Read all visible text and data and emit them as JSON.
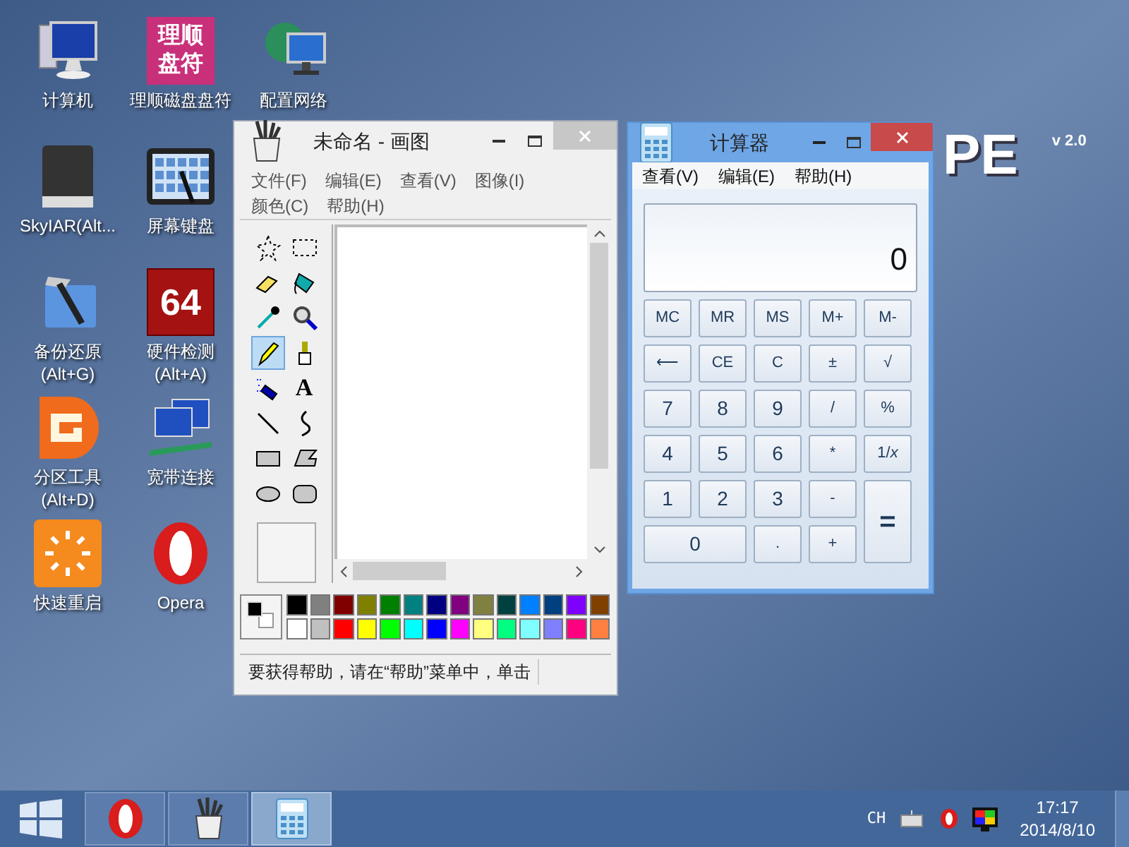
{
  "desktop_icons": [
    {
      "kind": "computer",
      "label": "计算机"
    },
    {
      "kind": "drive",
      "label": "SkyIAR(Alt..."
    },
    {
      "kind": "hammer",
      "label": "备份还原",
      "shortcut": "(Alt+G)"
    },
    {
      "kind": "partition",
      "label": "分区工具",
      "shortcut": "(Alt+D)"
    },
    {
      "kind": "restart",
      "label": "快速重启"
    },
    {
      "kind": "text_tile",
      "tile_text": "理顺盘符",
      "label": "理顺磁盘盘符"
    },
    {
      "kind": "keyboard",
      "label": "屏幕键盘"
    },
    {
      "kind": "number_tile",
      "tile_text": "64",
      "label": "硬件检测",
      "shortcut": "(Alt+A)"
    },
    {
      "kind": "network",
      "label": "宽带连接"
    },
    {
      "kind": "opera",
      "label": "Opera"
    },
    {
      "kind": "globe",
      "label": "配置网络"
    }
  ],
  "wallpaper_logo": {
    "title": "PE",
    "version": "v 2.0"
  },
  "paint_window": {
    "title": "未命名 - 画图",
    "menus": [
      "文件(F)",
      "编辑(E)",
      "查看(V)",
      "图像(I)",
      "颜色(C)",
      "帮助(H)"
    ],
    "tools": [
      {
        "kind": "free_select",
        "selected": false
      },
      {
        "kind": "rect_select",
        "selected": false
      },
      {
        "kind": "eraser",
        "selected": false
      },
      {
        "kind": "fill",
        "selected": false
      },
      {
        "kind": "picker",
        "selected": false
      },
      {
        "kind": "magnifier",
        "selected": false
      },
      {
        "kind": "pencil",
        "selected": true
      },
      {
        "kind": "brush",
        "selected": false
      },
      {
        "kind": "airbrush",
        "selected": false
      },
      {
        "kind": "text",
        "selected": false
      },
      {
        "kind": "line",
        "selected": false
      },
      {
        "kind": "curve",
        "selected": false
      },
      {
        "kind": "rectangle",
        "selected": false
      },
      {
        "kind": "polygon",
        "selected": false
      },
      {
        "kind": "ellipse",
        "selected": false
      },
      {
        "kind": "rounded_rect",
        "selected": false
      }
    ],
    "text_tool_letter": "A",
    "current_colors": [
      {
        "kind": "primary",
        "color": "#000000"
      },
      {
        "kind": "secondary",
        "color": "#ffffff"
      }
    ],
    "palette": [
      {
        "color": "#000000"
      },
      {
        "color": "#808080"
      },
      {
        "color": "#800000"
      },
      {
        "color": "#808000"
      },
      {
        "color": "#008000"
      },
      {
        "color": "#008080"
      },
      {
        "color": "#000080"
      },
      {
        "color": "#800080"
      },
      {
        "color": "#808040"
      },
      {
        "color": "#004040"
      },
      {
        "color": "#0080ff"
      },
      {
        "color": "#004080"
      },
      {
        "color": "#8000ff"
      },
      {
        "color": "#804000"
      },
      {
        "color": "#ffffff"
      },
      {
        "color": "#c0c0c0"
      },
      {
        "color": "#ff0000"
      },
      {
        "color": "#ffff00"
      },
      {
        "color": "#00ff00"
      },
      {
        "color": "#00ffff"
      },
      {
        "color": "#0000ff"
      },
      {
        "color": "#ff00ff"
      },
      {
        "color": "#ffff80"
      },
      {
        "color": "#00ff80"
      },
      {
        "color": "#80ffff"
      },
      {
        "color": "#8080ff"
      },
      {
        "color": "#ff0080"
      },
      {
        "color": "#ff8040"
      }
    ],
    "status_text": "要获得帮助，请在“帮助”菜单中，单击"
  },
  "calculator": {
    "title": "计算器",
    "menus": [
      "查看(V)",
      "编辑(E)",
      "帮助(H)"
    ],
    "display": "0",
    "buttons": [
      {
        "label": "MC",
        "kind": "memory"
      },
      {
        "label": "MR",
        "kind": "memory"
      },
      {
        "label": "MS",
        "kind": "memory"
      },
      {
        "label": "M+",
        "kind": "memory"
      },
      {
        "label": "M-",
        "kind": "memory"
      },
      {
        "label": "⟵",
        "kind": "op"
      },
      {
        "label": "CE",
        "kind": "op"
      },
      {
        "label": "C",
        "kind": "op"
      },
      {
        "label": "±",
        "kind": "op"
      },
      {
        "label": "√",
        "kind": "op"
      },
      {
        "label": "7",
        "kind": "digit"
      },
      {
        "label": "8",
        "kind": "digit"
      },
      {
        "label": "9",
        "kind": "digit"
      },
      {
        "label": "/",
        "kind": "op"
      },
      {
        "label": "%",
        "kind": "op"
      },
      {
        "label": "4",
        "kind": "digit"
      },
      {
        "label": "5",
        "kind": "digit"
      },
      {
        "label": "6",
        "kind": "digit"
      },
      {
        "label": "*",
        "kind": "op"
      },
      {
        "label": "1/*x*",
        "kind": "op"
      },
      {
        "label": "1",
        "kind": "digit"
      },
      {
        "label": "2",
        "kind": "digit"
      },
      {
        "label": "3",
        "kind": "digit"
      },
      {
        "label": "-",
        "kind": "op"
      },
      {
        "label": "=",
        "kind": "tall"
      },
      {
        "label": "0",
        "kind": "wide"
      },
      {
        "label": ".",
        "kind": "op"
      },
      {
        "label": "+",
        "kind": "op"
      }
    ]
  },
  "taskbar": {
    "apps": [
      {
        "kind": "opera",
        "selected": false
      },
      {
        "kind": "paint",
        "selected": false
      },
      {
        "kind": "calculator",
        "selected": true
      }
    ],
    "language": "CH",
    "time": "17:17",
    "date": "2014/8/10"
  }
}
